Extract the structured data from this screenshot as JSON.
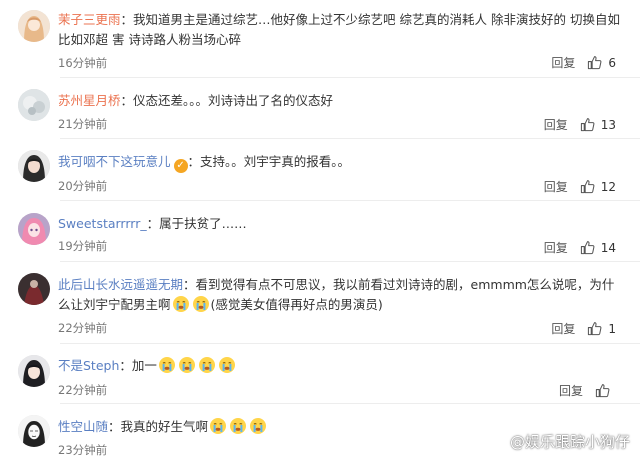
{
  "reply_label": "回复",
  "comments": [
    {
      "user": "茉子三更雨",
      "sep": "：",
      "text": "我知道男主是通过综艺…他好像上过不少综艺吧 综艺真的消耗人 除非演技好的 切换自如 比如邓超 害 诗诗路人粉当场心碎",
      "time": "16分钟前",
      "likes": "6",
      "avatar_icon": "girl-avatar-icon"
    },
    {
      "user": "苏州星月桥",
      "sep": "：",
      "text": "仪态还差。。。刘诗诗出了名的仪态好",
      "time": "21分钟前",
      "likes": "13",
      "avatar_icon": "flower-avatar-icon"
    },
    {
      "user": "我可咽不下这玩意儿",
      "sep": "：",
      "text": "支持。。刘宇宇真的报看。。",
      "time": "20分钟前",
      "likes": "12",
      "avatar_icon": "woman-avatar-icon",
      "badge_icon": "verified-badge-icon"
    },
    {
      "user": "Sweetstarrrrr_",
      "sep": "：",
      "text": "属于扶贫了……",
      "time": "19分钟前",
      "likes": "14",
      "avatar_icon": "anime-avatar-icon"
    },
    {
      "user": "此后山长水远遥遥无期",
      "sep": "：",
      "text_before": "看到觉得有点不可思议，我以前看过刘诗诗的剧，emmmm怎么说呢，为什么让刘宇宁配男主啊",
      "text_after": "(感觉美女值得再好点的男演员)",
      "time": "22分钟前",
      "likes": "1",
      "avatar_icon": "dark-avatar-icon",
      "emoji_icon": "crying-face-icon"
    },
    {
      "user": "不是Steph",
      "sep": "：",
      "text": "加一",
      "time": "22分钟前",
      "avatar_icon": "girl-dark-hair-avatar-icon",
      "emoji_icon": "crying-face-icon"
    },
    {
      "user": "性空山随",
      "sep": "：",
      "text": "我真的好生气啊",
      "time": "23分钟前",
      "avatar_icon": "sketch-avatar-icon",
      "emoji_icon": "crying-face-icon"
    }
  ],
  "watermark": "@娱乐跟踪小狗仔",
  "colors": {
    "username": "#eb7350",
    "username_alt": "#5a7fc2",
    "badge": "#f5a623"
  }
}
